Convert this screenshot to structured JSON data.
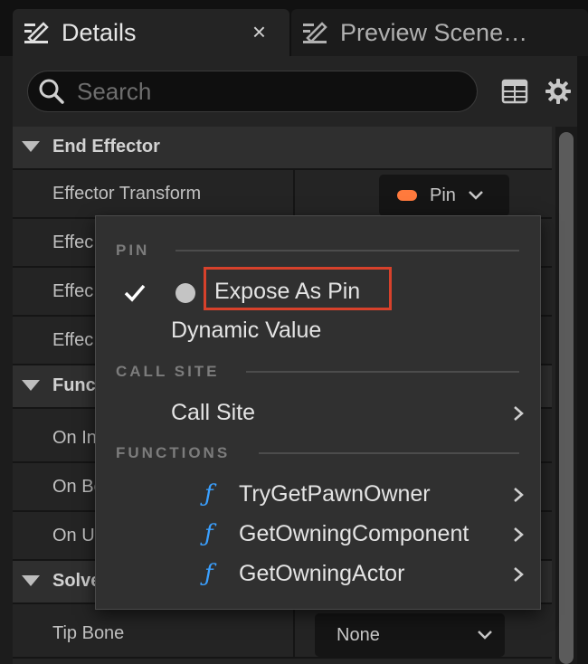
{
  "tabs": [
    {
      "label": "Details",
      "close": "×"
    },
    {
      "label": "Preview Scene…"
    }
  ],
  "search": {
    "placeholder": "Search"
  },
  "categories": {
    "end_effector": "End Effector",
    "functions": "Func",
    "solver": "Solve"
  },
  "properties": {
    "effector_transform": "Effector Transform",
    "effector_2": "Effec",
    "effector_3": "Effec",
    "effector_4": "Effec",
    "on_init": "On In",
    "on_become_relevant": "On Be",
    "on_update": "On U",
    "tip_bone": "Tip Bone"
  },
  "pin_button": {
    "label": "Pin",
    "swatch_color": "#ff7a3d"
  },
  "tip_bone_value": "None",
  "menu": {
    "pin_section": "PIN",
    "expose_as_pin": "Expose As Pin",
    "dynamic_value": "Dynamic Value",
    "call_site_section": "CALL SITE",
    "call_site": "Call Site",
    "functions_section": "FUNCTIONS",
    "functions": [
      "TryGetPawnOwner",
      "GetOwningComponent",
      "GetOwningActor"
    ],
    "function_glyph": "ƒ"
  },
  "colors": {
    "highlight": "#d7412b",
    "function_accent": "#3aa0ff"
  }
}
